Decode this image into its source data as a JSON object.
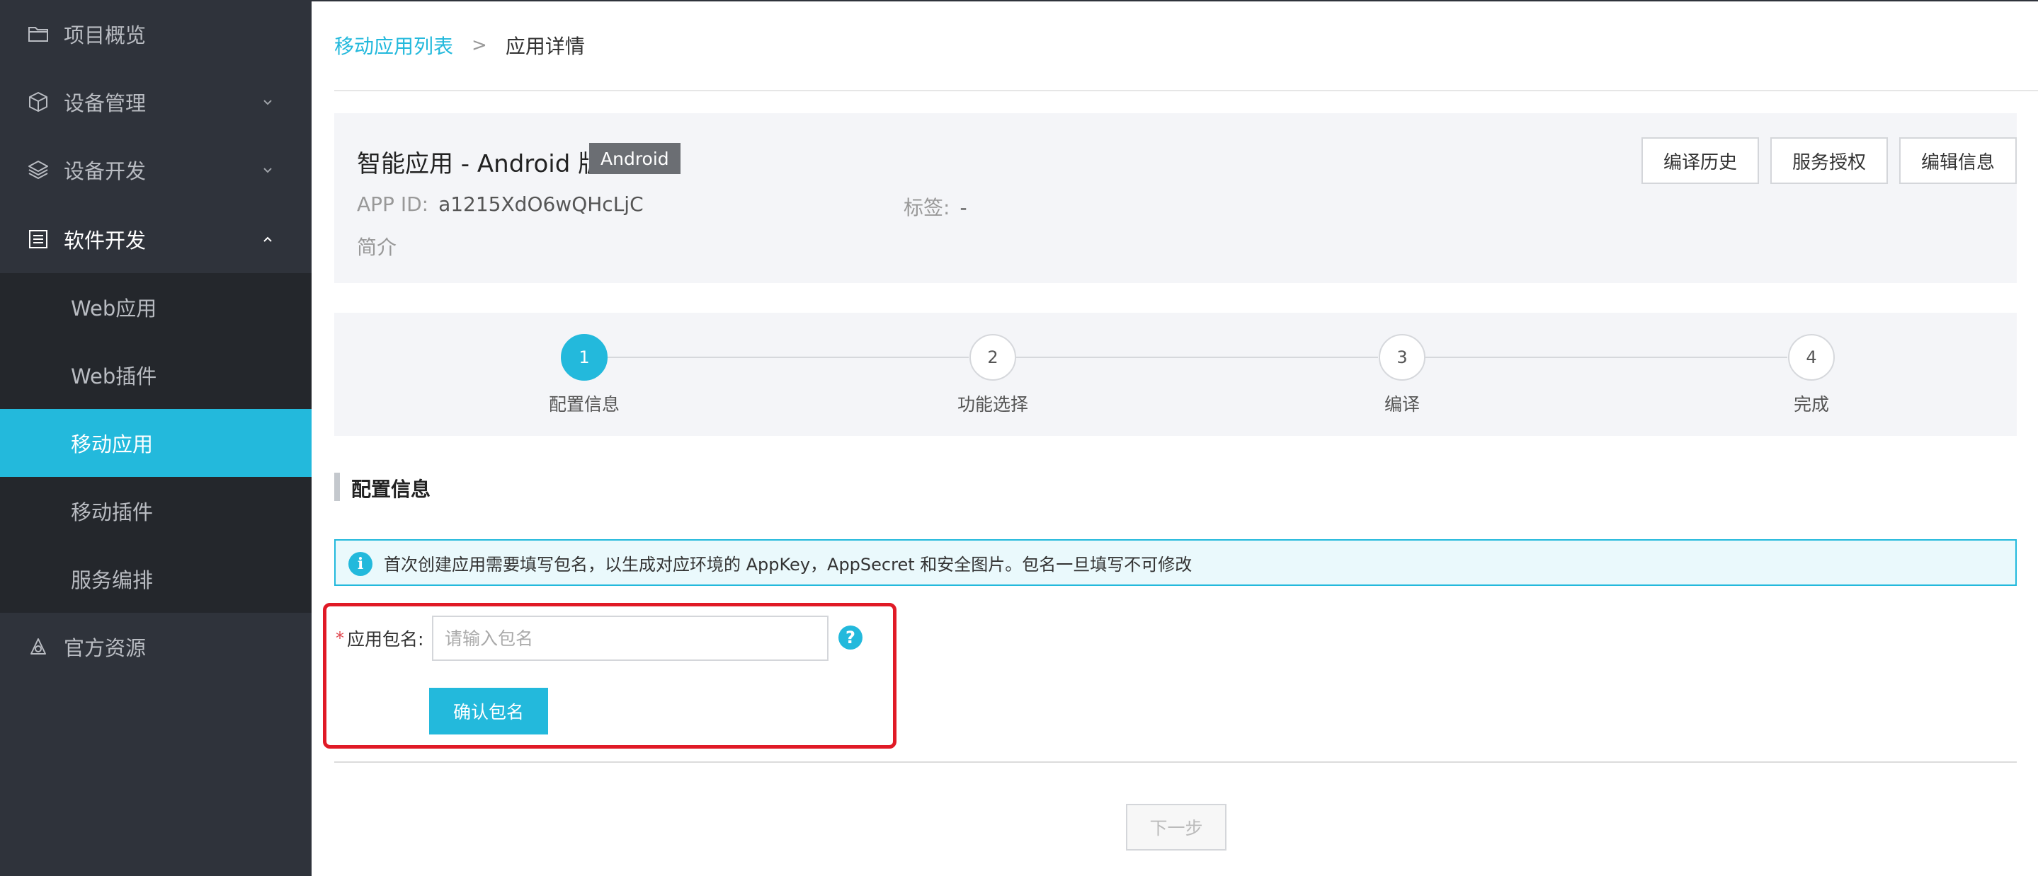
{
  "sidebar": {
    "items": [
      {
        "label": "项目概览",
        "icon": "folder-icon"
      },
      {
        "label": "设备管理",
        "icon": "cube-icon",
        "chevron": "down"
      },
      {
        "label": "设备开发",
        "icon": "layers-icon",
        "chevron": "down"
      },
      {
        "label": "软件开发",
        "icon": "document-icon",
        "chevron": "up"
      },
      {
        "label": "官方资源",
        "icon": "resource-icon"
      }
    ],
    "sub_items": [
      {
        "label": "Web应用"
      },
      {
        "label": "Web插件"
      },
      {
        "label": "移动应用",
        "active": true
      },
      {
        "label": "移动插件"
      },
      {
        "label": "服务编排"
      }
    ]
  },
  "breadcrumb": {
    "parent": "移动应用列表",
    "separator": ">",
    "current": "应用详情"
  },
  "app": {
    "title": "智能应用 - Android 版",
    "platform_badge": "Android",
    "app_id_label": "APP ID:",
    "app_id_value": "a1215XdO6wQHcLjC",
    "tags_label": "标签:",
    "tags_value": "-",
    "intro_label": "简介",
    "buttons": {
      "build_history": "编译历史",
      "service_auth": "服务授权",
      "edit_info": "编辑信息"
    }
  },
  "steps": [
    {
      "number": "1",
      "label": "配置信息",
      "active": true
    },
    {
      "number": "2",
      "label": "功能选择"
    },
    {
      "number": "3",
      "label": "编译"
    },
    {
      "number": "4",
      "label": "完成"
    }
  ],
  "section": {
    "title": "配置信息"
  },
  "alert": {
    "icon": "info-icon",
    "icon_glyph": "i",
    "text": "首次创建应用需要填写包名，以生成对应环境的 AppKey，AppSecret 和安全图片。包名一旦填写不可修改"
  },
  "form": {
    "required_mark": "*",
    "package_label": "应用包名:",
    "package_placeholder": "请输入包名",
    "package_value": "",
    "help_glyph": "?",
    "confirm_button": "确认包名"
  },
  "footer": {
    "next_button": "下一步"
  },
  "colors": {
    "accent": "#23b9dc",
    "sidebar_bg": "#2f333b",
    "sidebar_sub_bg": "#24272c",
    "highlight": "#e01a26"
  }
}
